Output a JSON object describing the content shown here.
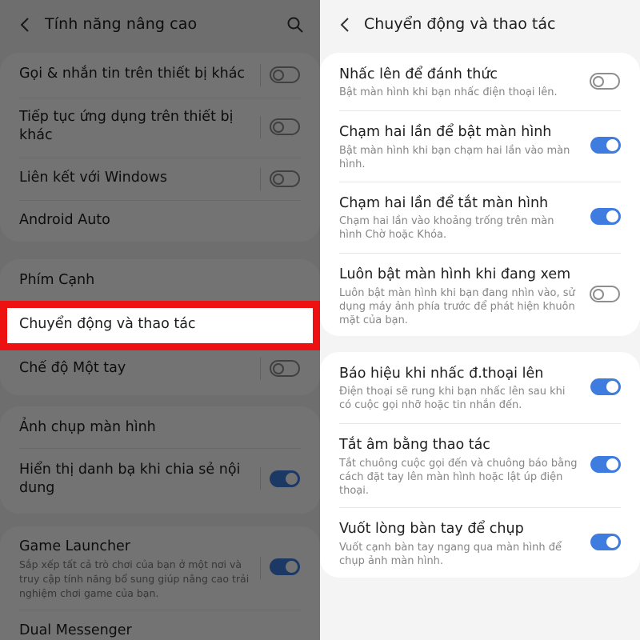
{
  "left": {
    "title": "Tính năng nâng cao",
    "rows": [
      {
        "label": "Gọi & nhắn tin trên thiết bị khác",
        "toggle": "off"
      },
      {
        "label": "Tiếp tục ứng dụng trên thiết bị khác",
        "toggle": "off"
      },
      {
        "label": "Liên kết với Windows",
        "toggle": "off"
      },
      {
        "label": "Android Auto"
      },
      {
        "label": "Phím Cạnh"
      },
      {
        "label": "Chuyển động và thao tác"
      },
      {
        "label": "Chế độ Một tay",
        "toggle": "off"
      },
      {
        "label": "Ảnh chụp màn hình"
      },
      {
        "label": "Hiển thị danh bạ khi chia sẻ nội dung",
        "toggle": "on"
      },
      {
        "label": "Game Launcher",
        "sub": "Sắp xếp tất cả trò chơi của bạn ở một nơi và truy cập tính năng bổ sung giúp nâng cao trải nghiệm chơi game của bạn.",
        "toggle": "on"
      },
      {
        "label": "Dual Messenger"
      }
    ]
  },
  "right": {
    "title": "Chuyển động và thao tác",
    "rows": [
      {
        "label": "Nhấc lên để đánh thức",
        "sub": "Bật màn hình khi bạn nhấc điện thoại lên.",
        "toggle": "off"
      },
      {
        "label": "Chạm hai lần để bật màn hình",
        "sub": "Bật màn hình khi bạn chạm hai lần vào màn hình.",
        "toggle": "on"
      },
      {
        "label": "Chạm hai lần để tắt màn hình",
        "sub": "Chạm hai lần vào khoảng trống trên màn hình Chờ hoặc Khóa.",
        "toggle": "on"
      },
      {
        "label": "Luôn bật màn hình khi đang xem",
        "sub": "Luôn bật màn hình khi bạn đang nhìn vào, sử dụng máy ảnh phía trước để phát hiện khuôn mặt của bạn.",
        "toggle": "off"
      },
      {
        "label": "Báo hiệu khi nhấc đ.thoại lên",
        "sub": "Điện thoại sẽ rung khi bạn nhấc lên sau khi có cuộc gọi nhỡ hoặc tin nhắn đến.",
        "toggle": "on"
      },
      {
        "label": "Tắt âm bằng thao tác",
        "sub": "Tắt chuông cuộc gọi đến và chuông báo bằng cách đặt tay lên màn hình hoặc lật úp điện thoại.",
        "toggle": "on"
      },
      {
        "label": "Vuốt lòng bàn tay để chụp",
        "sub": "Vuốt cạnh bàn tay ngang qua màn hình để chụp ảnh màn hình.",
        "toggle": "on"
      }
    ]
  },
  "colors": {
    "accent": "#3e7ce0",
    "highlight": "#ee1111"
  }
}
